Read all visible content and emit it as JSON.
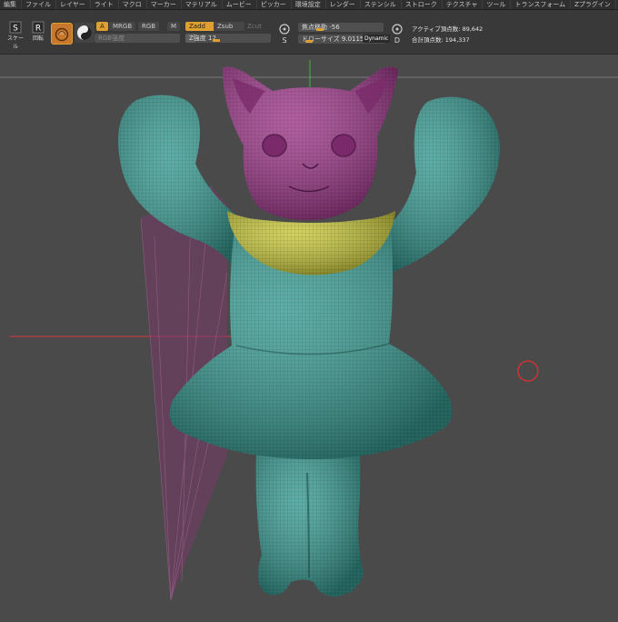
{
  "menu": [
    "編集",
    "ファイル",
    "レイヤー",
    "ライト",
    "マクロ",
    "マーカー",
    "マテリアル",
    "ムービー",
    "ピッカー",
    "環境設定",
    "レンダー",
    "ステンシル",
    "ストローク",
    "テクスチャ",
    "ツール",
    "トランスフォーム",
    "Zプラグイン",
    "Zスクリプト"
  ],
  "toolbar": {
    "scale_label": "スケール",
    "rotate_label": "回転",
    "scale_key": "S",
    "rotate_key": "R",
    "a_label": "A",
    "mrgb_label": "MRGB",
    "rgb_label": "RGB",
    "m_label": "M",
    "zadd_label": "Zadd",
    "zsub_label": "Zsub",
    "zcut_label": "Zcut",
    "rgb_intensity_label": "RGB強度",
    "z_intensity_label": "Z強度",
    "z_intensity_value": "12",
    "focal_shift_label": "焦点移動",
    "focal_shift_value": "-56",
    "draw_size_label": "ドローサイズ",
    "draw_size_value": "9.01158",
    "dynamic_label": "Dynamic",
    "s_key": "S",
    "d_key": "D",
    "active_points_label": "アクティブ頂点数:",
    "active_points_value": "89,642",
    "total_points_label": "合計頂点数:",
    "total_points_value": "194,337"
  },
  "colors": {
    "accent": "#e0a030",
    "body_teal": "#3a9c94",
    "head_magenta": "#a03a8c",
    "collar_yellow": "#c8c83c",
    "background": "#4a4a4a"
  },
  "icons": [
    "scale-icon",
    "rotate-icon",
    "brush-icon",
    "alpha-icon",
    "cursor-ring-icon"
  ]
}
